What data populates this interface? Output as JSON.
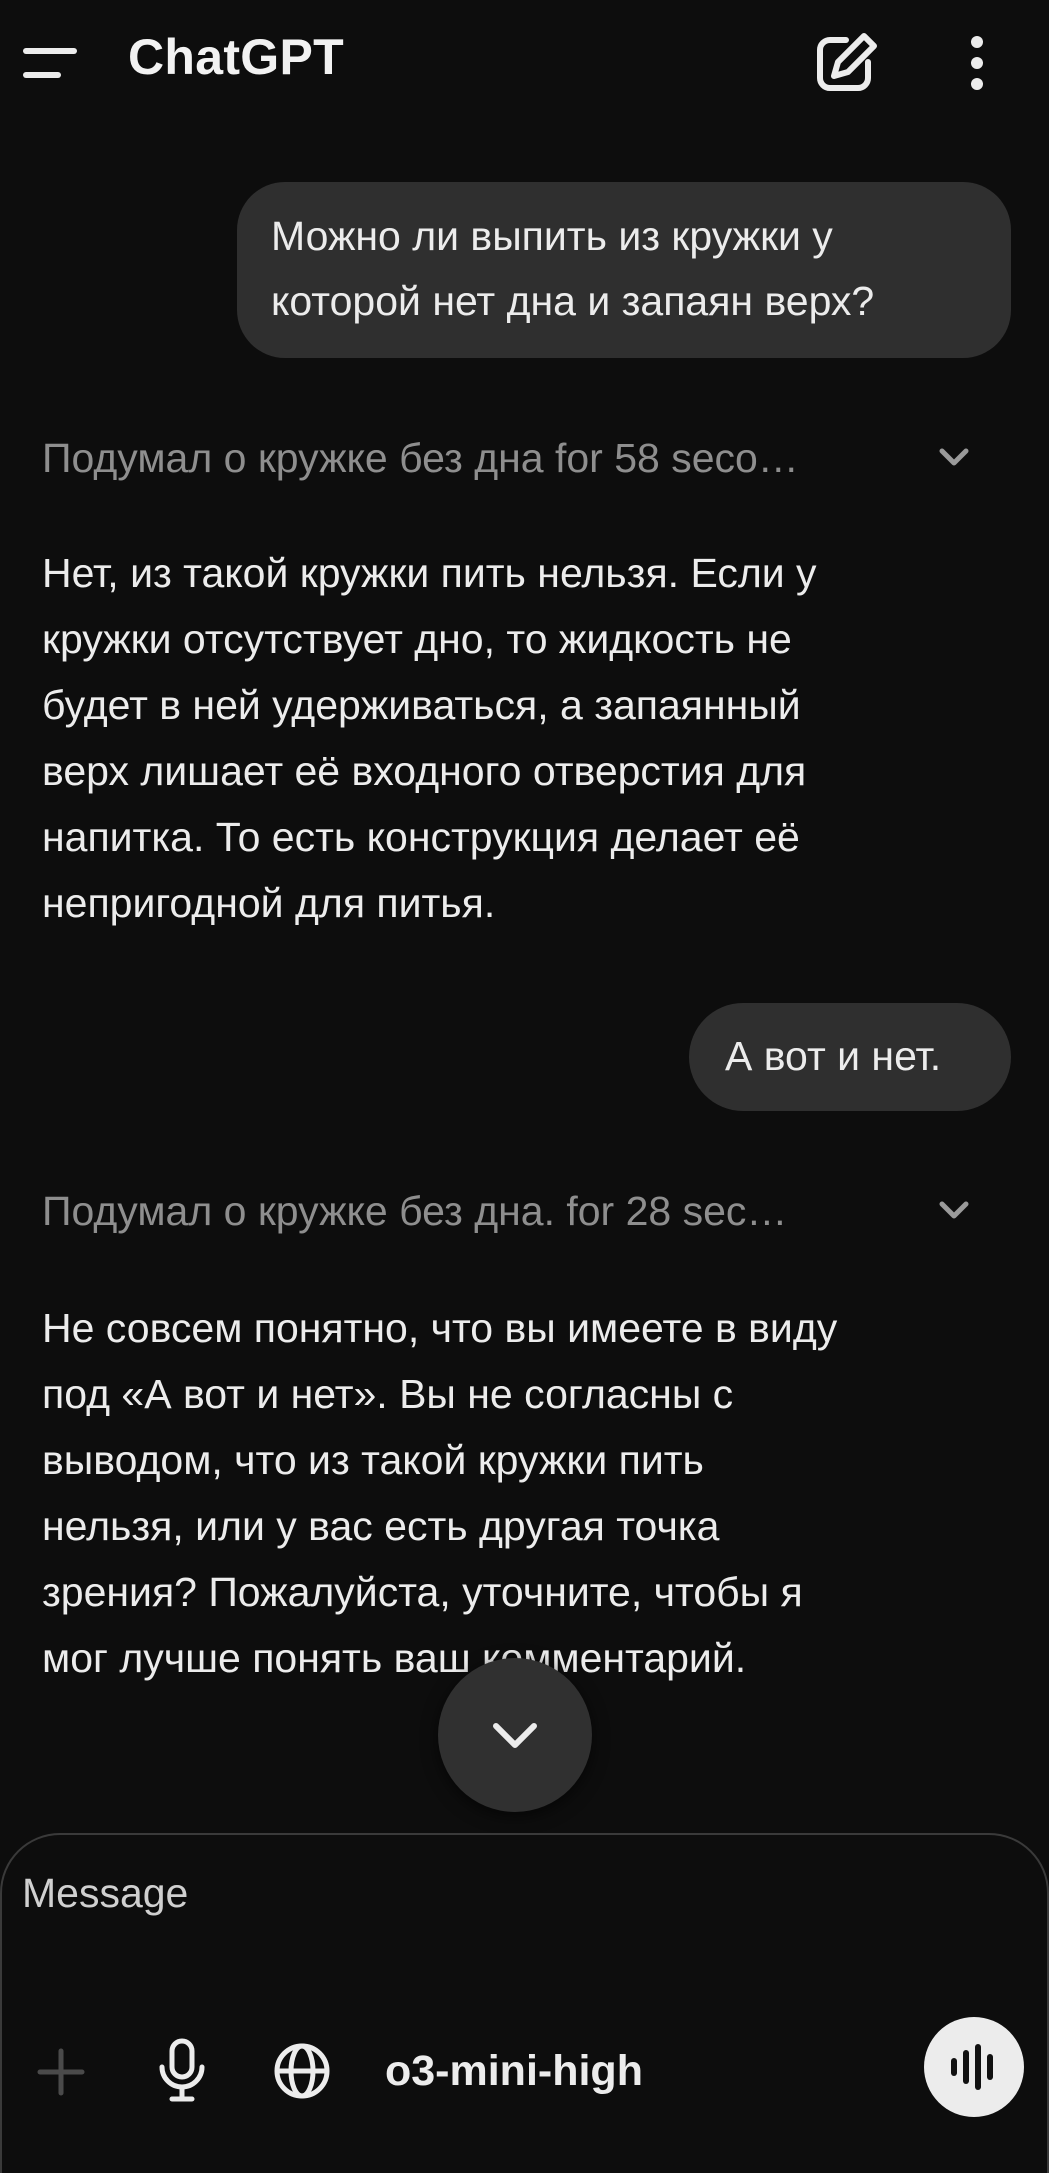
{
  "header": {
    "menu_icon": "hamburger-icon",
    "title": "ChatGPT",
    "new_chat_icon": "edit-icon",
    "more_icon": "kebab-icon"
  },
  "conversation": {
    "user_message_1": {
      "line1": "Можно ли выпить из кружки у",
      "line2": "которой нет дна и запаян верх?"
    },
    "thought_1": "Подумал о кружке без дна for 58 seco…",
    "assistant_message_1": [
      "Нет, из такой кружки пить нельзя. Если у",
      "кружки отсутствует дно, то жидкость не",
      "будет в ней удерживаться, а запаянный",
      "верх лишает её входного отверстия для",
      "напитка. То есть конструкция делает её",
      "непригодной для питья."
    ],
    "user_message_2": "А вот и нет.",
    "thought_2": "Подумал о кружке без дна. for 28 sec…",
    "assistant_message_2": [
      "Не совсем понятно, что вы имеете в виду",
      "под «А вот и нет». Вы не согласны с",
      "выводом, что из такой кружки пить",
      "нельзя, или у вас есть другая точка",
      "зрения? Пожалуйста, уточните, чтобы я",
      "мог лучше понять ваш комментарий."
    ]
  },
  "scroll_down_icon": "chevron-down-icon",
  "composer": {
    "placeholder": "Message",
    "model": "o3-mini-high",
    "plus_icon": "plus-icon",
    "mic_icon": "mic-icon",
    "globe_icon": "globe-icon",
    "voice_icon": "voice-mode-icon"
  },
  "colors": {
    "background": "#0d0d0d",
    "bubble": "#2f2f2f",
    "text": "#ececec",
    "muted": "#8e8e8e"
  }
}
